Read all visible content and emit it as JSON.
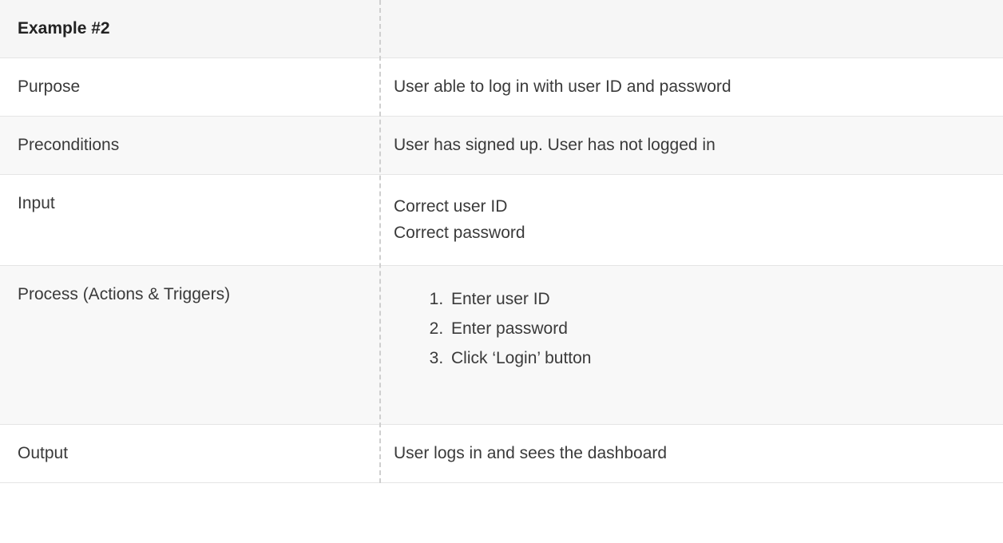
{
  "header": {
    "title": "Example #2"
  },
  "rows": {
    "purpose": {
      "label": "Purpose",
      "value": "User able to log in with user ID and password"
    },
    "preconditions": {
      "label": "Preconditions",
      "value": "User has signed up. User has not logged in"
    },
    "input": {
      "label": "Input",
      "line1": "Correct user ID",
      "line2": "Correct password"
    },
    "process": {
      "label": "Process (Actions & Triggers)",
      "step1": "Enter user ID",
      "step2": "Enter password",
      "step3": "Click ‘Login’ button"
    },
    "output": {
      "label": "Output",
      "value": "User logs in and sees the dashboard"
    }
  }
}
